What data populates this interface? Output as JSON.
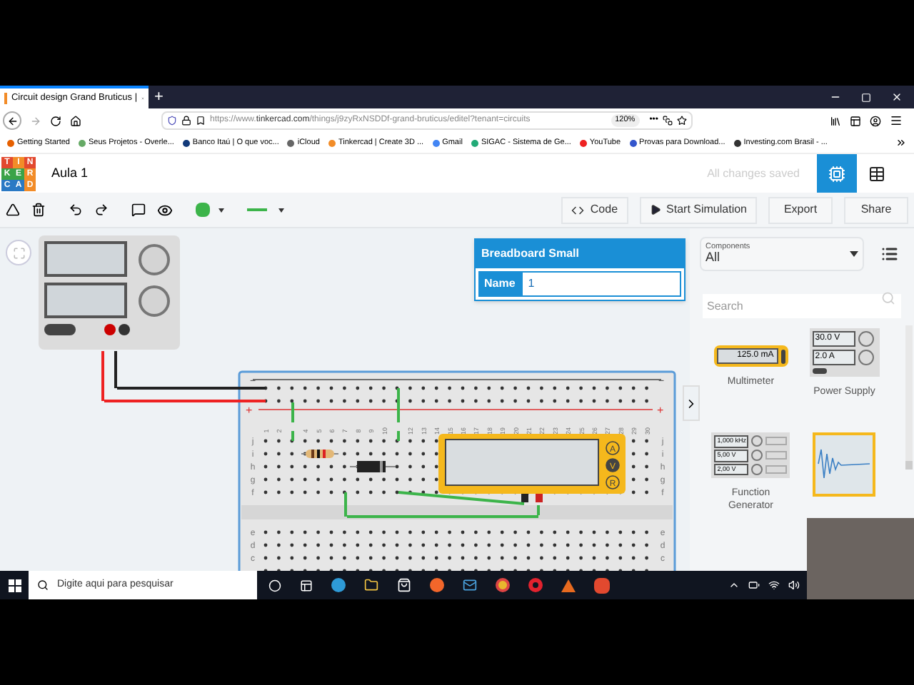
{
  "browser": {
    "tab_title": "Circuit design Grand Bruticus |",
    "new_tab": "+",
    "url_prefix": "https://www.",
    "url_domain": "tinkercad.com",
    "url_path": "/things/j9zyRxNSDDf-grand-bruticus/editel?tenant=circuits",
    "zoom": "120%",
    "more": "•••"
  },
  "bookmarks": [
    "Getting Started",
    "Seus Projetos - Overle...",
    "Banco Itaú | O que voc...",
    "iCloud",
    "Tinkercad | Create 3D ...",
    "Gmail",
    "SIGAC - Sistema de Ge...",
    "YouTube",
    "Provas para Download...",
    "Investing.com Brasil - ..."
  ],
  "app": {
    "logo_letters": [
      "T",
      "I",
      "N",
      "K",
      "E",
      "R",
      "C",
      "A",
      "D"
    ],
    "project": "Aula 1",
    "save_status": "All changes saved",
    "views": [
      {
        "kind": "circuit",
        "selected": true
      },
      {
        "kind": "list",
        "selected": false
      }
    ]
  },
  "toolbar": {
    "color": "#3cb44a",
    "buttons": [
      {
        "kind": "code",
        "label": "Code"
      },
      {
        "kind": "simulate",
        "label": "Start Simulation"
      },
      {
        "kind": "plain",
        "label": "Export"
      },
      {
        "kind": "plain",
        "label": "Share"
      }
    ]
  },
  "properties": {
    "title": "Breadboard Small",
    "field_label": "Name",
    "field_value": "1"
  },
  "breadboard": {
    "column_numbers": [
      "1",
      "2",
      "4",
      "5",
      "6",
      "7",
      "8",
      "9",
      "10",
      "12",
      "13",
      "14",
      "15",
      "16",
      "17",
      "18",
      "19",
      "20",
      "21",
      "22",
      "23",
      "24",
      "25",
      "26",
      "27",
      "28",
      "29",
      "30"
    ],
    "rows_top": [
      {
        "left": "j",
        "right": "j"
      },
      {
        "left": "i",
        "right": "i"
      },
      {
        "left": "h",
        "right": "h"
      },
      {
        "left": "g",
        "right": "g"
      },
      {
        "left": "f",
        "right": "f"
      }
    ],
    "rows_bottom": [
      {
        "left": "e",
        "right": "e"
      },
      {
        "left": "d",
        "right": "d"
      },
      {
        "left": "c",
        "right": "c"
      }
    ],
    "rail_minus": "−",
    "rail_plus": "+",
    "meter_modes": [
      "A",
      "V",
      "R"
    ]
  },
  "components": {
    "label": "Components",
    "filter": "All",
    "search_placeholder": "Search",
    "items": [
      {
        "kind": "multimeter",
        "name": "Multimeter",
        "readings": [
          "125.0 mA"
        ]
      },
      {
        "kind": "power_supply",
        "name": "Power Supply",
        "readings": [
          "30.0 V",
          "2.0 A"
        ]
      },
      {
        "kind": "function_generator",
        "name": "Function Generator",
        "readings": [
          "1,000 kHz",
          "5,00 V",
          "2,00 V"
        ]
      },
      {
        "kind": "oscilloscope"
      }
    ]
  },
  "taskbar": {
    "search_placeholder": "Digite aqui para pesquisar"
  }
}
